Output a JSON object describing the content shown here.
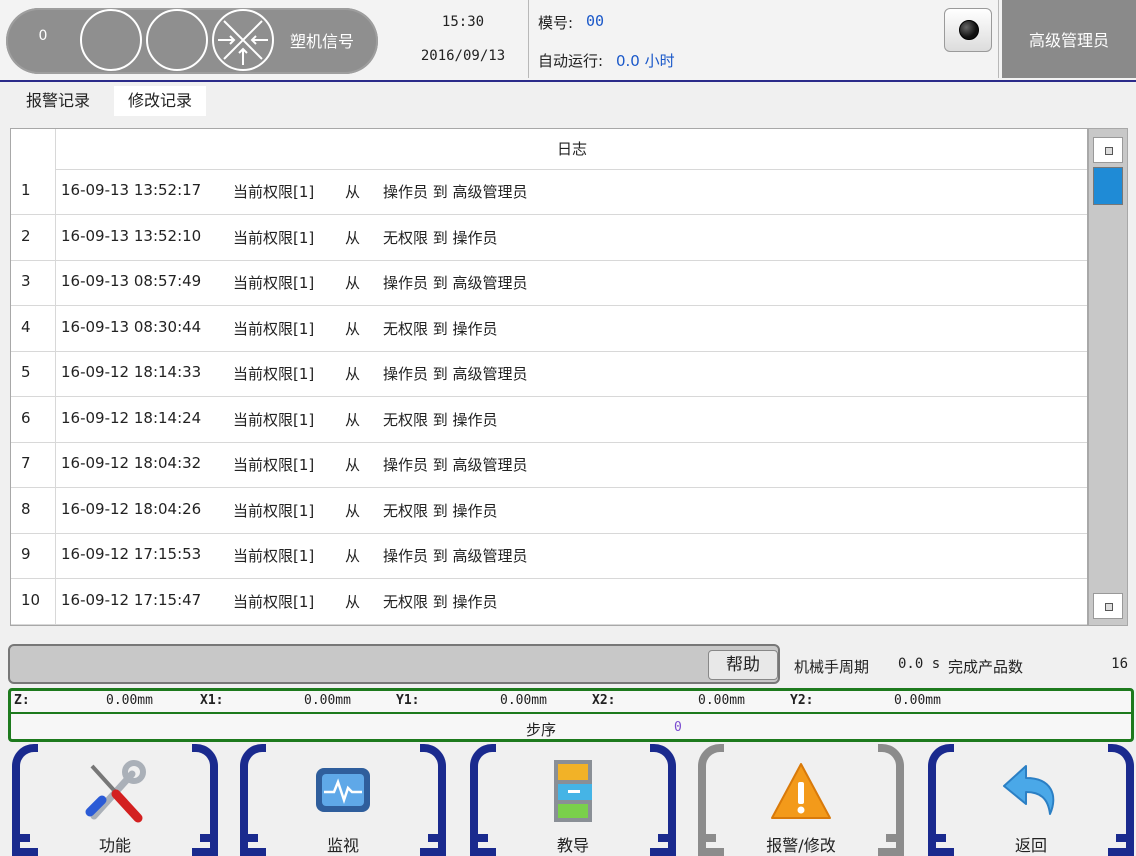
{
  "header": {
    "counter": "0",
    "signal_label": "塑机信号",
    "time": "15:30",
    "date": "2016/09/13",
    "mold_label": "模号:",
    "mold_value": "00",
    "auto_label": "自动运行:",
    "auto_value": "0.0 小时",
    "user_level": "高级管理员"
  },
  "tabs": [
    {
      "label": "报警记录",
      "active": false
    },
    {
      "label": "修改记录",
      "active": true
    }
  ],
  "log": {
    "column_header": "日志",
    "rows": [
      {
        "index": "1",
        "timestamp": "16-09-13 13:52:17",
        "permission": "当前权限[1]",
        "from": "从",
        "change": "操作员 到 高级管理员"
      },
      {
        "index": "2",
        "timestamp": "16-09-13 13:52:10",
        "permission": "当前权限[1]",
        "from": "从",
        "change": "无权限 到 操作员"
      },
      {
        "index": "3",
        "timestamp": "16-09-13 08:57:49",
        "permission": "当前权限[1]",
        "from": "从",
        "change": "操作员 到 高级管理员"
      },
      {
        "index": "4",
        "timestamp": "16-09-13 08:30:44",
        "permission": "当前权限[1]",
        "from": "从",
        "change": "无权限 到 操作员"
      },
      {
        "index": "5",
        "timestamp": "16-09-12 18:14:33",
        "permission": "当前权限[1]",
        "from": "从",
        "change": "操作员 到 高级管理员"
      },
      {
        "index": "6",
        "timestamp": "16-09-12 18:14:24",
        "permission": "当前权限[1]",
        "from": "从",
        "change": "无权限 到 操作员"
      },
      {
        "index": "7",
        "timestamp": "16-09-12 18:04:32",
        "permission": "当前权限[1]",
        "from": "从",
        "change": "操作员 到 高级管理员"
      },
      {
        "index": "8",
        "timestamp": "16-09-12 18:04:26",
        "permission": "当前权限[1]",
        "from": "从",
        "change": "无权限 到 操作员"
      },
      {
        "index": "9",
        "timestamp": "16-09-12 17:15:53",
        "permission": "当前权限[1]",
        "from": "从",
        "change": "操作员 到 高级管理员"
      },
      {
        "index": "10",
        "timestamp": "16-09-12 17:15:47",
        "permission": "当前权限[1]",
        "from": "从",
        "change": "无权限 到 操作员"
      }
    ]
  },
  "status": {
    "help_label": "帮助",
    "cycle_label": "机械手周期",
    "cycle_value": "0.0 s",
    "produced_label": "完成产品数",
    "produced_value": "16"
  },
  "axes": {
    "z_label": "Z:",
    "z_value": "0.00mm",
    "x1_label": "X1:",
    "x1_value": "0.00mm",
    "y1_label": "Y1:",
    "y1_value": "0.00mm",
    "x2_label": "X2:",
    "x2_value": "0.00mm",
    "y2_label": "Y2:",
    "y2_value": "0.00mm",
    "step_label": "步序",
    "step_value": "0"
  },
  "nav": [
    {
      "label": "功能",
      "icon": "tools-icon"
    },
    {
      "label": "监视",
      "icon": "monitor-icon"
    },
    {
      "label": "教导",
      "icon": "cabinet-icon"
    },
    {
      "label": "报警/修改",
      "icon": "warning-icon",
      "active": true
    },
    {
      "label": "返回",
      "icon": "back-arrow-icon"
    }
  ],
  "colors": {
    "nav_border": "#1a2a8e",
    "nav_active_border": "#8c8c8c",
    "axis_border": "#1d7a1d",
    "value_blue": "#1a58c9",
    "scroll_thumb": "#1f8bd6"
  }
}
